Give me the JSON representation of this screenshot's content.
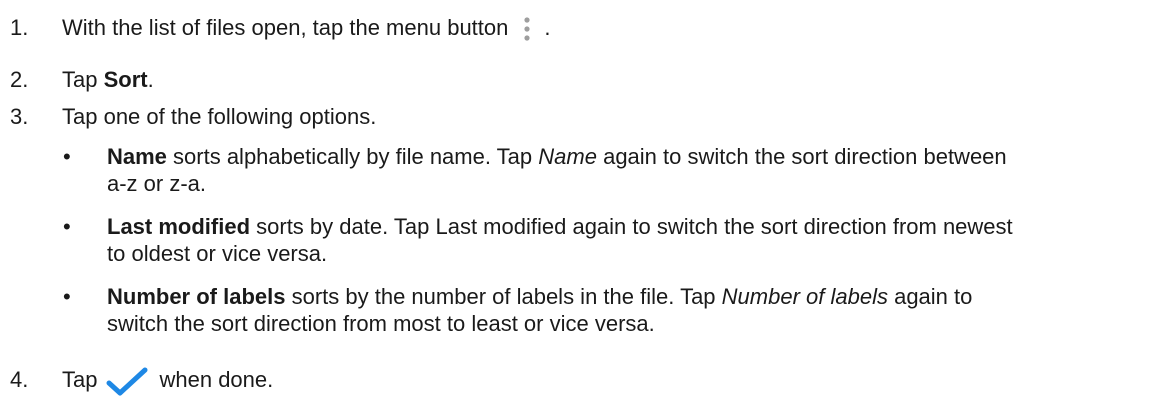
{
  "steps": [
    {
      "number": "1.",
      "text_before_icon": "With the list of files open, tap the menu button",
      "icon": "vertical-ellipsis-menu-icon",
      "text_after_icon": "."
    },
    {
      "number": "2.",
      "prefix": "Tap ",
      "bold": "Sort",
      "suffix": "."
    },
    {
      "number": "3.",
      "text": "Tap one of the following options."
    },
    {
      "number": "4.",
      "prefix": "Tap",
      "icon": "checkmark-icon",
      "suffix": "when done."
    }
  ],
  "options": [
    {
      "bullet": "•",
      "bold": "Name",
      "text_1": " sorts alphabetically by file name. Tap ",
      "italic": "Name",
      "text_2": " again to switch the sort direction between",
      "line_2": "a-z or z-a."
    },
    {
      "bullet": "•",
      "bold": "Last modified",
      "text_1": " sorts by date. Tap Last modified again to switch the sort direction from newest",
      "line_2": "to oldest or vice versa."
    },
    {
      "bullet": "•",
      "bold": "Number of labels",
      "text_1": " sorts by the number of labels in the file. Tap ",
      "italic": "Number of labels",
      "text_2": " again to",
      "line_2": "switch the sort direction from most to least or vice versa."
    }
  ],
  "colors": {
    "text": "#1a1a1a",
    "menu_icon": "#9e9e9e",
    "checkmark": "#1e88e5"
  }
}
